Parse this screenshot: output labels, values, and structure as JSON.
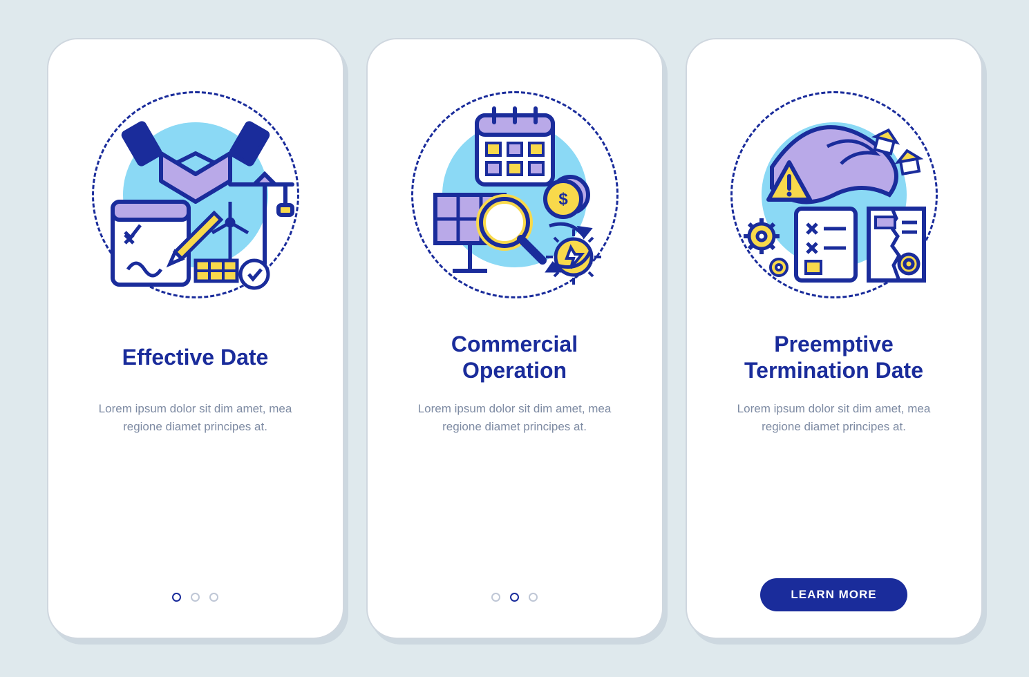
{
  "screens": [
    {
      "title": "Effective Date",
      "body": "Lorem ipsum dolor sit dim amet, mea regione diamet principes at.",
      "activeDot": 0,
      "icon": "handshake-contract"
    },
    {
      "title": "Commercial Operation",
      "body": "Lorem ipsum dolor sit dim amet, mea regione diamet principes at.",
      "activeDot": 1,
      "icon": "calendar-energy"
    },
    {
      "title": "Preemptive Termination Date",
      "body": "Lorem ipsum dolor sit dim amet, mea regione diamet principes at.",
      "cta": "LEARN MORE",
      "icon": "wave-warning-docs"
    }
  ],
  "colors": {
    "primary": "#1a2c9b",
    "accent": "#f8d94b",
    "lilac": "#b9a9e8",
    "sky": "#8bd9f5",
    "grey": "#7e8ba3"
  }
}
